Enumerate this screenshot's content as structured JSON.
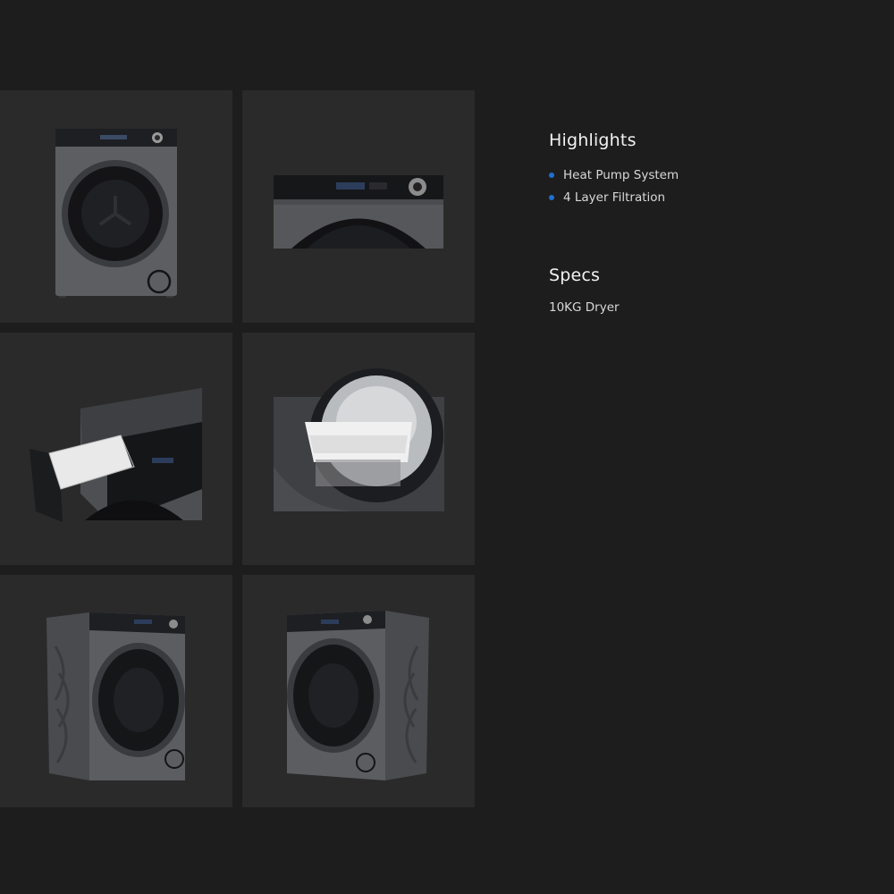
{
  "gallery": {
    "images": [
      {
        "alt": "dryer-front-view"
      },
      {
        "alt": "dryer-control-panel-closeup"
      },
      {
        "alt": "dryer-detergent-drawer-open"
      },
      {
        "alt": "dryer-drum-interior-closeup"
      },
      {
        "alt": "dryer-left-angle-view"
      },
      {
        "alt": "dryer-right-angle-view"
      }
    ]
  },
  "highlights": {
    "title": "Highlights",
    "items": [
      "Heat Pump System",
      "4 Layer Filtration"
    ],
    "bullet_color": "#1f6fd1"
  },
  "specs": {
    "title": "Specs",
    "items": [
      "10KG Dryer"
    ]
  },
  "colors": {
    "page_background": "#1d1d1d",
    "tile_background": "#2a2a2a",
    "accent": "#1f6fd1"
  }
}
